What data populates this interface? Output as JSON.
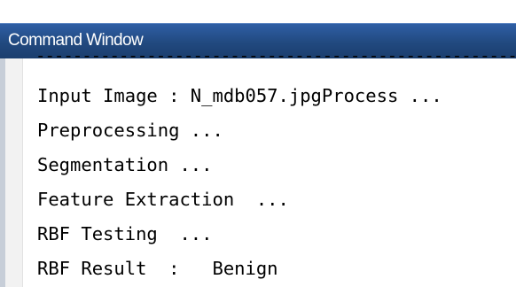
{
  "window": {
    "title": "Command Window"
  },
  "output": {
    "separator": "------------------------------------------------------------",
    "lines": [
      "Input Image : N_mdb057.jpgProcess ...",
      "Preprocessing ...",
      "Segmentation ...",
      "Feature Extraction  ...",
      "RBF Testing  ...",
      "RBF Result  :   Benign"
    ]
  }
}
